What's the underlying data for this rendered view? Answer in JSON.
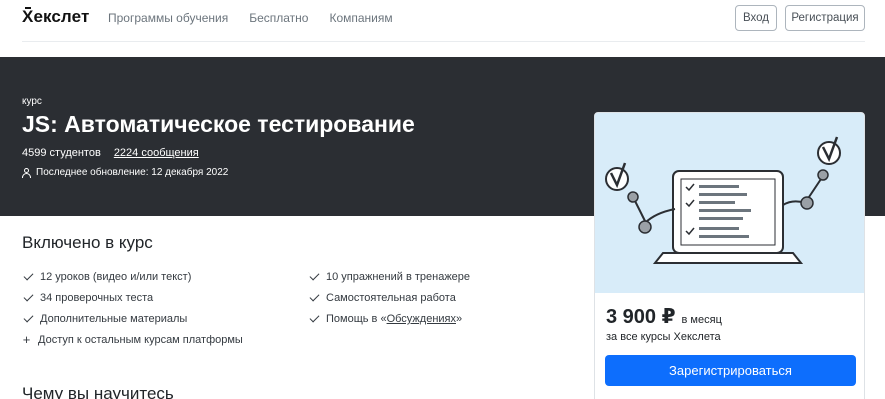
{
  "header": {
    "logo": "Хекслет",
    "nav": [
      "Программы обучения",
      "Бесплатно",
      "Компаниям"
    ],
    "login": "Вход",
    "register": "Регистрация"
  },
  "hero": {
    "kicker": "курс",
    "title": "JS: Автоматическое тестирование",
    "students": "4599 студентов",
    "messages": "2224 сообщения",
    "updated": "Последнее обновление: 12 декабря 2022"
  },
  "included": {
    "title": "Включено в курс",
    "left": [
      {
        "icon": "check-icon",
        "text": "12 уроков (видео и/или текст)"
      },
      {
        "icon": "check-icon",
        "text": "34 проверочных теста"
      },
      {
        "icon": "check-icon",
        "text": "Дополнительные материалы"
      },
      {
        "icon": "plus-icon",
        "text": "Доступ к остальным курсам платформы"
      }
    ],
    "right": [
      {
        "icon": "check-icon",
        "text": "10 упражнений в тренажере"
      },
      {
        "icon": "check-icon",
        "text": "Самостоятельная работа"
      },
      {
        "icon": "check-icon",
        "text": "Помощь в «",
        "link": "Обсуждениях",
        "suffix": "»"
      }
    ]
  },
  "learn": {
    "title": "Чему вы научитесь"
  },
  "card": {
    "price": "3 900 ₽",
    "period": "в месяц",
    "note": "за все курсы Хекслета",
    "button": "Зарегистрироваться"
  },
  "colors": {
    "hero_bg": "#2b2e33",
    "accent": "#0d6efd",
    "illustration_bg": "#d8ecf9"
  }
}
